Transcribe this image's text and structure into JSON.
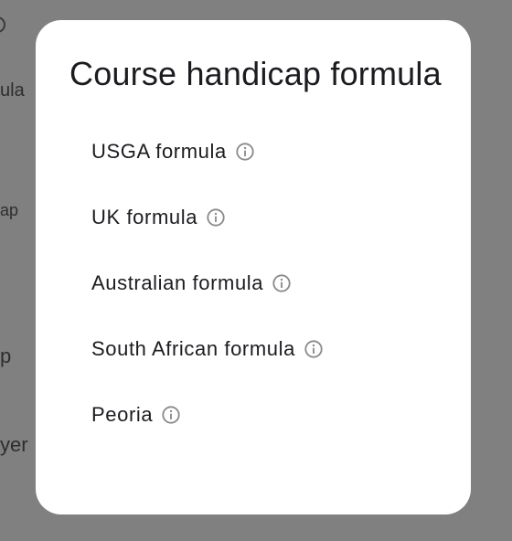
{
  "background": {
    "fragments": [
      "ula",
      "ap",
      "p",
      "yer"
    ]
  },
  "dialog": {
    "title": "Course handicap formula",
    "options": [
      {
        "label": "USGA formula",
        "icon": "info-icon"
      },
      {
        "label": "UK formula",
        "icon": "info-icon"
      },
      {
        "label": "Australian formula",
        "icon": "info-icon"
      },
      {
        "label": "South African formula",
        "icon": "info-icon"
      },
      {
        "label": "Peoria",
        "icon": "info-icon"
      }
    ]
  },
  "colors": {
    "scrim": "#808080",
    "dialog_surface": "#ffffff",
    "text": "#1c1b1f",
    "icon": "#8a8a8a"
  }
}
